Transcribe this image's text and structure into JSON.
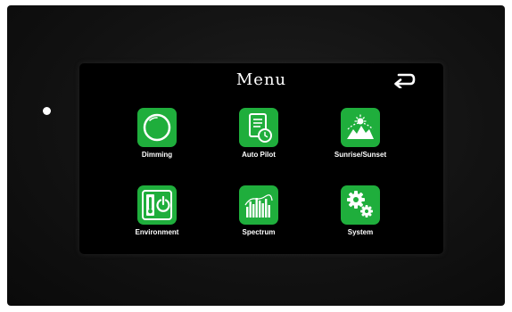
{
  "screen": {
    "title": "Menu",
    "back_icon": "back-arrow-icon"
  },
  "menu": {
    "items": [
      {
        "label": "Dimming",
        "icon": "dimming-circle-icon"
      },
      {
        "label": "Auto Pilot",
        "icon": "auto-pilot-document-clock-icon"
      },
      {
        "label": "Sunrise/Sunset",
        "icon": "sunrise-sunset-icon"
      },
      {
        "label": "Environment",
        "icon": "environment-thermometer-power-icon"
      },
      {
        "label": "Spectrum",
        "icon": "spectrum-bars-icon"
      },
      {
        "label": "System",
        "icon": "system-gears-icon"
      }
    ]
  },
  "colors": {
    "accent": "#1fae3c",
    "background": "#000000",
    "text": "#ffffff"
  }
}
